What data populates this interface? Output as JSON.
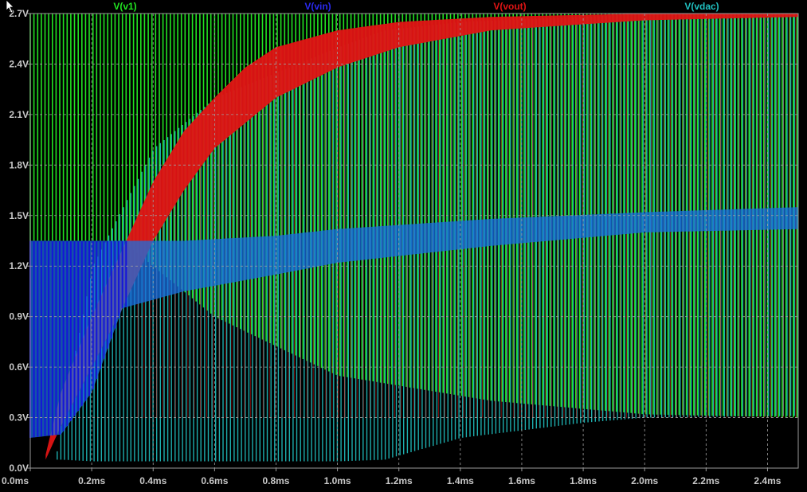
{
  "chart_data": {
    "type": "line",
    "title": "",
    "xlabel": "",
    "ylabel": "",
    "x_ticks": [
      "0.0ms",
      "0.2ms",
      "0.4ms",
      "0.6ms",
      "0.8ms",
      "1.0ms",
      "1.2ms",
      "1.4ms",
      "1.6ms",
      "1.8ms",
      "2.0ms",
      "2.2ms",
      "2.4ms"
    ],
    "y_ticks": [
      "0.0V",
      "0.3V",
      "0.6V",
      "0.9V",
      "1.2V",
      "1.5V",
      "1.8V",
      "2.1V",
      "2.4V",
      "2.7V"
    ],
    "xlim": [
      0.0,
      2.5
    ],
    "ylim": [
      0.0,
      2.7
    ],
    "x_unit": "ms",
    "y_unit": "V",
    "grid": true,
    "legend_position": "top",
    "background": "#000000",
    "series": [
      {
        "name": "V(v1)",
        "color": "#22e322",
        "style": "square-wave",
        "description_values": {
          "high": 2.7,
          "low_start": 1.35,
          "low_end": 0.3
        },
        "envelope": [
          [
            0.0,
            2.7,
            1.35
          ],
          [
            0.3,
            2.7,
            1.35
          ],
          [
            0.6,
            2.7,
            0.9
          ],
          [
            1.0,
            2.7,
            0.55
          ],
          [
            1.5,
            2.7,
            0.4
          ],
          [
            2.0,
            2.7,
            0.32
          ],
          [
            2.5,
            2.7,
            0.3
          ]
        ]
      },
      {
        "name": "V(vin)",
        "color": "#1414d8",
        "style": "band",
        "envelope": [
          [
            0.0,
            0.18,
            1.35
          ],
          [
            0.1,
            0.2,
            1.35
          ],
          [
            0.2,
            0.45,
            1.35
          ],
          [
            0.3,
            0.95,
            1.35
          ],
          [
            0.5,
            1.05,
            1.35
          ],
          [
            0.8,
            1.15,
            1.38
          ],
          [
            1.0,
            1.22,
            1.42
          ],
          [
            1.5,
            1.32,
            1.48
          ],
          [
            2.0,
            1.4,
            1.52
          ],
          [
            2.5,
            1.42,
            1.55
          ]
        ]
      },
      {
        "name": "V(vout)",
        "color": "#e01414",
        "style": "band",
        "envelope": [
          [
            0.0,
            0.05,
            0.05
          ],
          [
            0.05,
            0.05,
            0.08
          ],
          [
            0.1,
            0.25,
            0.45
          ],
          [
            0.2,
            0.6,
            0.9
          ],
          [
            0.3,
            0.95,
            1.3
          ],
          [
            0.4,
            1.35,
            1.7
          ],
          [
            0.5,
            1.65,
            2.0
          ],
          [
            0.6,
            1.9,
            2.2
          ],
          [
            0.7,
            2.05,
            2.38
          ],
          [
            0.8,
            2.2,
            2.5
          ],
          [
            1.0,
            2.38,
            2.6
          ],
          [
            1.2,
            2.5,
            2.65
          ],
          [
            1.5,
            2.6,
            2.68
          ],
          [
            2.0,
            2.66,
            2.7
          ],
          [
            2.5,
            2.68,
            2.7
          ]
        ],
        "oscillation": {
          "low": 0.3,
          "high": 2.7
        }
      },
      {
        "name": "V(vdac)",
        "color": "#20c0c0",
        "style": "square-wave",
        "envelope": [
          [
            0.0,
            0.05,
            0.05
          ],
          [
            0.08,
            0.05,
            0.05
          ],
          [
            0.1,
            0.05,
            0.3
          ],
          [
            0.2,
            0.04,
            1.2
          ],
          [
            0.4,
            0.04,
            1.9
          ],
          [
            0.6,
            0.04,
            2.2
          ],
          [
            1.0,
            0.04,
            2.5
          ],
          [
            1.15,
            0.05,
            2.6
          ],
          [
            1.4,
            0.18,
            2.65
          ],
          [
            1.8,
            0.27,
            2.68
          ],
          [
            2.0,
            0.3,
            2.7
          ],
          [
            2.5,
            0.31,
            2.7
          ]
        ]
      }
    ]
  }
}
